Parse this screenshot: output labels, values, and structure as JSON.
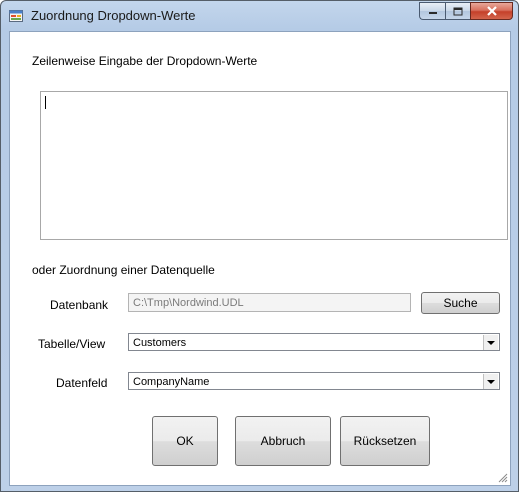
{
  "window": {
    "title": "Zuordnung Dropdown-Werte"
  },
  "labels": {
    "entry_heading": "Zeilenweise Eingabe der Dropdown-Werte",
    "datasource_heading": "oder Zuordnung einer Datenquelle",
    "database": "Datenbank",
    "table_view": "Tabelle/View",
    "data_field": "Datenfeld"
  },
  "inputs": {
    "values_text": "",
    "database_path": "C:\\Tmp\\Nordwind.UDL",
    "table_value": "Customers",
    "field_value": "CompanyName"
  },
  "buttons": {
    "search": "Suche",
    "ok": "OK",
    "cancel": "Abbruch",
    "reset": "Rücksetzen"
  },
  "icons": {
    "app": "form-icon",
    "minimize": "minimize-icon",
    "maximize": "maximize-icon",
    "close": "close-icon",
    "dropdown": "chevron-down-icon",
    "resize": "resize-grip-icon"
  },
  "colors": {
    "title_bar": "#b5cbe6",
    "close_button": "#c4402a",
    "client_background": "#ffffff"
  }
}
